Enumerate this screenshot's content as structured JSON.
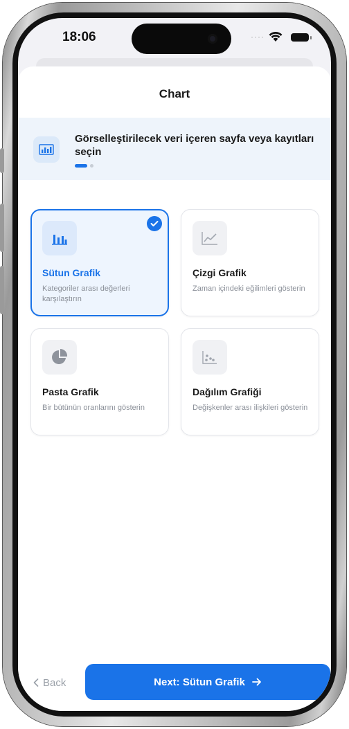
{
  "status_bar": {
    "time": "18:06"
  },
  "sheet": {
    "title": "Chart"
  },
  "step": {
    "text": "Görselleştirilecek veri içeren sayfa veya kayıtları seçin",
    "icon": "bar-chart-icon",
    "current_step": 1,
    "total_steps": 2
  },
  "chart_types": [
    {
      "title": "Sütun Grafik",
      "description": "Kategoriler arası değerleri karşılaştırın",
      "icon": "column-chart-icon",
      "selected": true
    },
    {
      "title": "Çizgi Grafik",
      "description": "Zaman içindeki eğilimleri gösterin",
      "icon": "line-chart-icon",
      "selected": false
    },
    {
      "title": "Pasta Grafik",
      "description": "Bir bütünün oranlarını gösterin",
      "icon": "pie-chart-icon",
      "selected": false
    },
    {
      "title": "Dağılım Grafiği",
      "description": "Değişkenler arası ilişkileri gösterin",
      "icon": "scatter-chart-icon",
      "selected": false
    }
  ],
  "footer": {
    "back_label": "Back",
    "next_label": "Next: Sütun Grafik"
  },
  "colors": {
    "accent": "#1a73e8",
    "selected_card_bg": "#eef5fe",
    "banner_bg": "#eef4fb",
    "muted_text": "#8a8f98"
  }
}
